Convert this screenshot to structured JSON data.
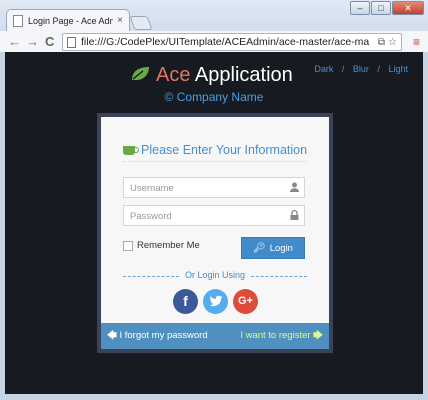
{
  "browser": {
    "tab_title": "Login Page - Ace Admin",
    "tab_close": "×",
    "url": "file:///G:/CodePlex/UITemplate/ACEAdmin/ace-master/ace-ma",
    "back": "←",
    "forward": "→",
    "reload": "C",
    "menu": "≡",
    "window_buttons": [
      "–",
      "□",
      "✕"
    ]
  },
  "page": {
    "brand_ace": "Ace",
    "brand_app": "Application",
    "company": "© Company Name",
    "themes": [
      "Dark",
      "Blur",
      "Light"
    ],
    "theme_sep": "/",
    "login": {
      "heading": "Please Enter Your Information",
      "username_placeholder": "Username",
      "password_placeholder": "Password",
      "remember_label": "Remember Me",
      "login_button": "Login",
      "or_login_using": "Or Login Using",
      "social": [
        "f",
        "t",
        "G+"
      ],
      "forgot": "I forgot my password",
      "register": "I want to register"
    }
  },
  "colors": {
    "page_bg": "#171b21",
    "accent_blue": "#428bca",
    "ace_red": "#e2755f",
    "footer_bg": "#5090c1",
    "register_green": "#dbfc8a"
  }
}
